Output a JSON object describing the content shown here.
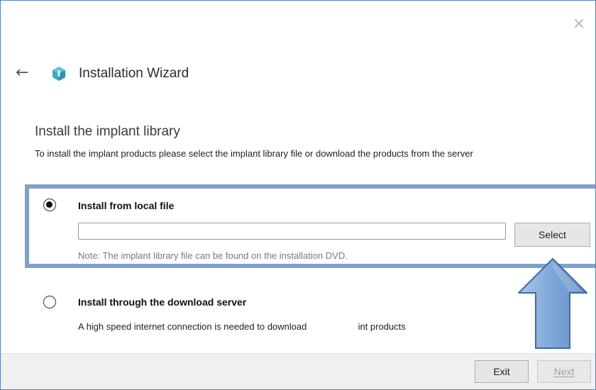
{
  "window": {
    "title": "Installation Wizard",
    "close_icon": "close-icon",
    "back_icon": "back-arrow-icon",
    "logo_icon": "app-logo-icon"
  },
  "section": {
    "heading": "Install the implant library",
    "description": "To install the implant products please select the implant library file or download the products from the server"
  },
  "options": {
    "local": {
      "label": "Install from local file",
      "selected": true,
      "input_value": "",
      "select_button": "Select",
      "note": "Note: The implant library file can be found on the installation DVD."
    },
    "server": {
      "label": "Install through the download server",
      "selected": false,
      "description": "A high speed internet connection is needed to download                    int products"
    }
  },
  "footer": {
    "exit_button": "Exit",
    "next_button": "Next"
  },
  "colors": {
    "window_border": "#4a86c8",
    "highlight_border": "#7fa1cc",
    "arrow_fill": "#8ab0dd",
    "footer_bg": "#f0f0f0"
  }
}
